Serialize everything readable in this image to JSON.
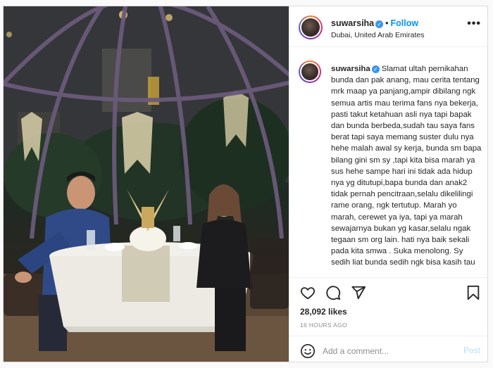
{
  "post": {
    "username": "suwarsiha",
    "location": "Dubai, United Arab Emirates",
    "follow_label": "Follow",
    "separator": "•",
    "more_label": "•••",
    "caption": "Slamat ultah pernikahan bunda dan pak anang, mau cerita tentang mrk maap ya panjang,ampir dibilang ngk semua artis mau terima fans nya bekerja, pasti takut ketahuan asli nya tapi bapak dan bunda berbeda,sudah tau saya fans berat tapi saya memang suster dulu nya hehe malah awal sy kerja, bunda sm bapa bilang gini sm sy ,tapi kita bisa marah ya sus hehe sampe hari ini tidak ada hidup nya yg ditutupi,bapa bunda dan anak2 tidak pernah pencitraan,selalu dikelilingi rame orang, ngk tertutup. Marah yo marah, cerewet ya iya, tapi ya marah sewajarnya bukan yg kasar,selalu ngak tegaan sm org lain. hati nya baik sekali pada kita smwa . Suka menolong. Sy sedih liat bunda sedih ngk bisa kasih tau",
    "likes": "28,092 likes",
    "time_ago": "16 HOURS AGO",
    "comment_placeholder": "Add a comment...",
    "post_label": "Post"
  },
  "icons": {
    "verified": "verified-badge-icon",
    "like": "heart-icon",
    "comment": "comment-bubble-icon",
    "share": "paper-plane-icon",
    "save": "bookmark-icon",
    "emoji": "smiley-icon",
    "more": "ellipsis-icon"
  },
  "colors": {
    "link_blue": "#0095f6",
    "verified_blue": "#3897f0",
    "post_disabled": "#b2dffc",
    "muted": "#8e8e8e",
    "border": "#dbdbdb"
  }
}
